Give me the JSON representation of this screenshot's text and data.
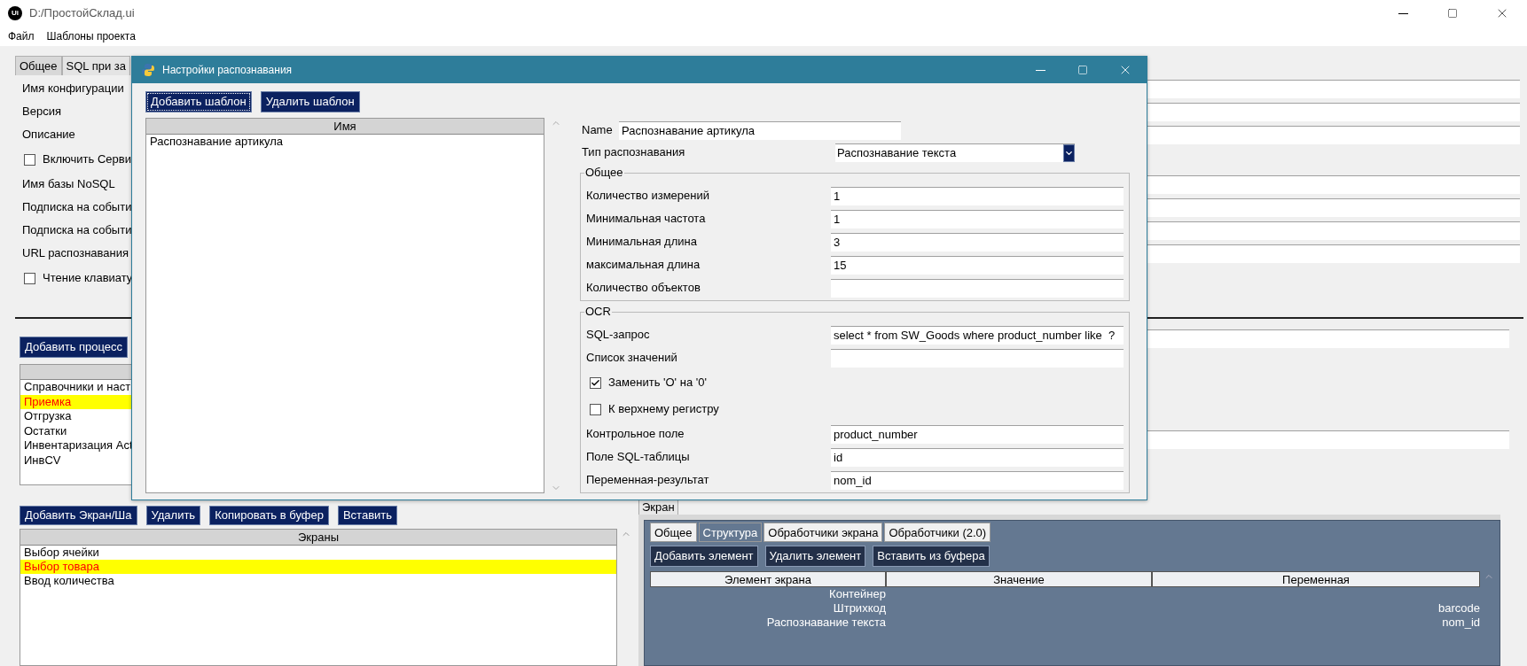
{
  "window": {
    "icon_text": "Ui",
    "title": "D:/ПростойСклад.ui"
  },
  "menu": [
    "Файл",
    "Шаблоны проекта"
  ],
  "config_tabs": [
    {
      "label": "Общее",
      "selected": true
    },
    {
      "label": "SQL при за",
      "selected": false
    }
  ],
  "config_rows": [
    {
      "kind": "field",
      "label": "Имя конфигурации"
    },
    {
      "kind": "field",
      "label": "Версия"
    },
    {
      "kind": "field",
      "label": "Описание"
    },
    {
      "kind": "checkbox",
      "label": "Включить Серви",
      "checked": false
    },
    {
      "kind": "field",
      "label": "Имя базы NoSQL"
    },
    {
      "kind": "field",
      "label": "Подписка на событи"
    },
    {
      "kind": "field",
      "label": "Подписка на событи"
    },
    {
      "kind": "field",
      "label": "URL распознавания"
    },
    {
      "kind": "checkbox",
      "label": "Чтение клавиату",
      "checked": false
    }
  ],
  "process_button": "Добавить процесс",
  "processes": [
    {
      "label": "Справочники и наст",
      "selected": false
    },
    {
      "label": "Приемка",
      "selected": true
    },
    {
      "label": "Отгрузка",
      "selected": false
    },
    {
      "label": "Остатки",
      "selected": false
    },
    {
      "label": "Инвентаризация Act",
      "selected": false
    },
    {
      "label": "ИнвCV",
      "selected": false
    }
  ],
  "screen_buttons": [
    "Добавить Экран/Ша",
    "Удалить",
    "Копировать в буфер",
    "Вставить"
  ],
  "screens": {
    "column": "Экраны",
    "items": [
      {
        "label": "Выбор ячейки",
        "selected": false
      },
      {
        "label": "Выбор товара",
        "selected": true
      },
      {
        "label": "Ввод количества",
        "selected": false
      }
    ]
  },
  "screen_panel": {
    "tab": "Экран",
    "tabs": [
      {
        "label": "Общее",
        "selected": false
      },
      {
        "label": "Структура",
        "selected": true
      },
      {
        "label": "Обработчики экрана",
        "selected": false
      },
      {
        "label": "Обработчики (2.0)",
        "selected": false
      }
    ],
    "buttons": [
      "Добавить элемент",
      "Удалить элемент",
      "Вставить из буфера"
    ],
    "columns": [
      "Элемент экрана",
      "Значение",
      "Переменная"
    ],
    "rows": [
      {
        "element": "Контейнер"
      },
      {
        "element": "Штрихкод",
        "variable": "barcode"
      },
      {
        "element": "Распознавание текста",
        "variable": "nom_id"
      }
    ]
  },
  "dialog": {
    "title": "Настройки распознавания",
    "buttons": [
      {
        "label": "Добавить шаблон",
        "focused": true
      },
      {
        "label": "Удалить шаблон",
        "focused": false
      }
    ],
    "list": {
      "column": "Имя",
      "items": [
        "Распознавание артикула"
      ]
    },
    "name": {
      "label": "Name",
      "value": "Распознавание артикула"
    },
    "type": {
      "label": "Тип распознавания",
      "value": "Распознавание текста"
    },
    "groups": [
      {
        "title": "Общее",
        "rows": [
          {
            "kind": "field",
            "label": "Количество измерений",
            "value": "1"
          },
          {
            "kind": "field",
            "label": "Минимальная частота",
            "value": "1"
          },
          {
            "kind": "field",
            "label": "Минимальная длина",
            "value": "3"
          },
          {
            "kind": "field",
            "label": "максимальная длина",
            "value": "15"
          },
          {
            "kind": "field",
            "label": "Количество объектов"
          }
        ]
      },
      {
        "title": "OCR",
        "rows": [
          {
            "kind": "field",
            "label": "SQL-запрос",
            "value": "select * from SW_Goods where product_number like  ?"
          },
          {
            "kind": "field",
            "label": "Список значений"
          },
          {
            "kind": "checkbox",
            "label": "Заменить 'O' на '0'",
            "checked": true
          },
          {
            "kind": "checkbox",
            "label": "К верхнему регистру",
            "checked": false
          },
          {
            "kind": "field",
            "label": "Контрольное поле",
            "value": "product_number"
          },
          {
            "kind": "field",
            "label": "Поле SQL-таблицы",
            "value": "id"
          },
          {
            "kind": "field",
            "label": "Переменная-результат",
            "value": "nom_id"
          }
        ]
      }
    ]
  }
}
